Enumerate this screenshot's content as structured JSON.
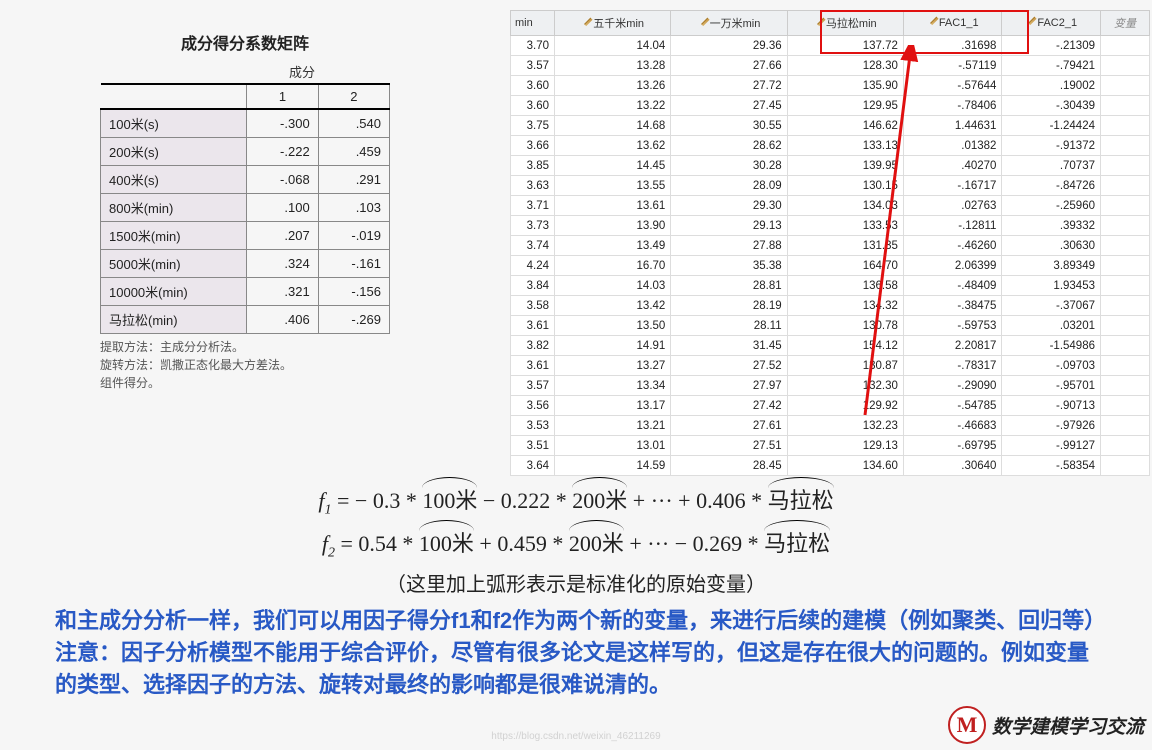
{
  "matrix": {
    "title": "成分得分系数矩阵",
    "subhead": "成分",
    "col1": "1",
    "col2": "2",
    "rows": [
      {
        "label": "100米(s)",
        "v1": "-.300",
        "v2": ".540"
      },
      {
        "label": "200米(s)",
        "v1": "-.222",
        "v2": ".459"
      },
      {
        "label": "400米(s)",
        "v1": "-.068",
        "v2": ".291"
      },
      {
        "label": "800米(min)",
        "v1": ".100",
        "v2": ".103"
      },
      {
        "label": "1500米(min)",
        "v1": ".207",
        "v2": "-.019"
      },
      {
        "label": "5000米(min)",
        "v1": ".324",
        "v2": "-.161"
      },
      {
        "label": "10000米(min)",
        "v1": ".321",
        "v2": "-.156"
      },
      {
        "label": "马拉松(min)",
        "v1": ".406",
        "v2": "-.269"
      }
    ],
    "foot1": "提取方法：主成分分析法。",
    "foot2": "旋转方法：凯撒正态化最大方差法。",
    "foot3": "组件得分。"
  },
  "data": {
    "headers": [
      "min",
      "五千米min",
      "一万米min",
      "马拉松min",
      "FAC1_1",
      "FAC2_1",
      "变量"
    ],
    "rows": [
      [
        "3.70",
        "14.04",
        "29.36",
        "137.72",
        ".31698",
        "-.21309"
      ],
      [
        "3.57",
        "13.28",
        "27.66",
        "128.30",
        "-.57119",
        "-.79421"
      ],
      [
        "3.60",
        "13.26",
        "27.72",
        "135.90",
        "-.57644",
        ".19002"
      ],
      [
        "3.60",
        "13.22",
        "27.45",
        "129.95",
        "-.78406",
        "-.30439"
      ],
      [
        "3.75",
        "14.68",
        "30.55",
        "146.62",
        "1.44631",
        "-1.24424"
      ],
      [
        "3.66",
        "13.62",
        "28.62",
        "133.13",
        ".01382",
        "-.91372"
      ],
      [
        "3.85",
        "14.45",
        "30.28",
        "139.95",
        ".40270",
        ".70737"
      ],
      [
        "3.63",
        "13.55",
        "28.09",
        "130.15",
        "-.16717",
        "-.84726"
      ],
      [
        "3.71",
        "13.61",
        "29.30",
        "134.03",
        ".02763",
        "-.25960"
      ],
      [
        "3.73",
        "13.90",
        "29.13",
        "133.53",
        "-.12811",
        ".39332"
      ],
      [
        "3.74",
        "13.49",
        "27.88",
        "131.35",
        "-.46260",
        ".30630"
      ],
      [
        "4.24",
        "16.70",
        "35.38",
        "164.70",
        "2.06399",
        "3.89349"
      ],
      [
        "3.84",
        "14.03",
        "28.81",
        "136.58",
        "-.48409",
        "1.93453"
      ],
      [
        "3.58",
        "13.42",
        "28.19",
        "134.32",
        "-.38475",
        "-.37067"
      ],
      [
        "3.61",
        "13.50",
        "28.11",
        "130.78",
        "-.59753",
        ".03201"
      ],
      [
        "3.82",
        "14.91",
        "31.45",
        "154.12",
        "2.20817",
        "-1.54986"
      ],
      [
        "3.61",
        "13.27",
        "27.52",
        "130.87",
        "-.78317",
        "-.09703"
      ],
      [
        "3.57",
        "13.34",
        "27.97",
        "132.30",
        "-.29090",
        "-.95701"
      ],
      [
        "3.56",
        "13.17",
        "27.42",
        "129.92",
        "-.54785",
        "-.90713"
      ],
      [
        "3.53",
        "13.21",
        "27.61",
        "132.23",
        "-.46683",
        "-.97926"
      ],
      [
        "3.51",
        "13.01",
        "27.51",
        "129.13",
        "-.69795",
        "-.99127"
      ],
      [
        "3.64",
        "14.59",
        "28.45",
        "134.60",
        ".30640",
        "-.58354"
      ]
    ]
  },
  "formulas": {
    "f1_prefix": "f",
    "f1_sub": "1",
    "f1_mid1": " = − 0.3 * ",
    "f1_v1": "100米",
    "f1_mid2": " − 0.222 * ",
    "f1_v2": "200米",
    "f1_mid3": " + ··· + 0.406 * ",
    "f1_v3": "马拉松",
    "f2_sub": "2",
    "f2_mid1": " = 0.54 * ",
    "f2_mid2": " + 0.459 * ",
    "f2_mid3": " + ··· − 0.269 * ",
    "note": "（这里加上弧形表示是标准化的原始变量）"
  },
  "blue": {
    "line1": "和主成分分析一样，我们可以用因子得分f1和f2作为两个新的变量，来进行后续的建模（例如聚类、回归等）",
    "line2": "注意：因子分析模型不能用于综合评价，尽管有很多论文是这样写的，但这是存在很大的问题的。例如变量的类型、选择因子的方法、旋转对最终的影响都是很难说清的。"
  },
  "brand": {
    "logo": "M",
    "text": "数学建模学习交流"
  }
}
